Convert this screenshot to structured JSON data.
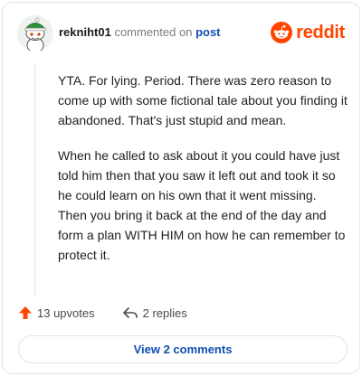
{
  "comment": {
    "username": "rekniht01",
    "commented_label": "commented on",
    "post_label": "post",
    "paragraphs": [
      "YTA. For lying. Period. There was zero reason to come up with some fictional tale about you finding it abandoned. That's just stupid and mean.",
      "When he called to ask about it you could have just told him then that you saw it left out and took it so he could learn on his own that it went missing. Then you bring it back at the end of the day and form a plan WITH HIM on how he can remember to protect it."
    ],
    "upvotes_label": "13 upvotes",
    "replies_label": "2 replies"
  },
  "brand": {
    "name": "reddit",
    "color": "#ff4500",
    "icon": "reddit-snoo-icon"
  },
  "view_comments_label": "View 2 comments",
  "colors": {
    "accent_link": "#0f4fb3",
    "upvote": "#ff4500"
  }
}
